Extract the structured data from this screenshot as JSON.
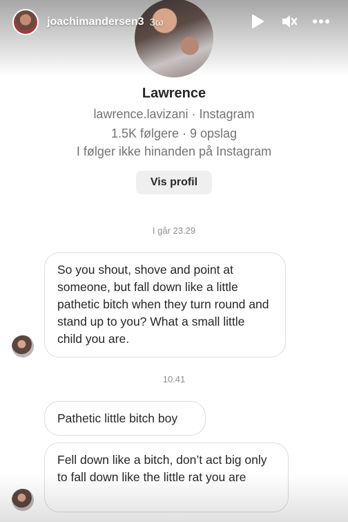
{
  "story": {
    "username": "joachimandersen3",
    "time_ago": "3ω",
    "controls": {
      "play_icon": "play-icon",
      "mute_icon": "mute-icon",
      "more_icon": "more-icon"
    }
  },
  "profile": {
    "name": "Lawrence",
    "handle_line": "lawrence.lavizani · Instagram",
    "stats_line": "1.5K følgere · 9 opslag",
    "follow_status": "I følger ikke hinanden på Instagram",
    "view_profile_label": "Vis profil"
  },
  "conversation": {
    "timestamp_1": "I går 23.29",
    "message_1": "So you shout, shove and point at someone, but fall down like a little pathetic bitch when they turn round and stand up to you? What a small little child you are.",
    "timestamp_2": "10.41",
    "message_2": "Pathetic little bitch boy",
    "message_3": "Fell down like a bitch, don’t act big only to fall down like the little rat you are"
  },
  "colors": {
    "text_primary": "#262626",
    "text_secondary": "#737373",
    "bubble_border": "#dbdbdb",
    "button_bg": "#efefef"
  }
}
